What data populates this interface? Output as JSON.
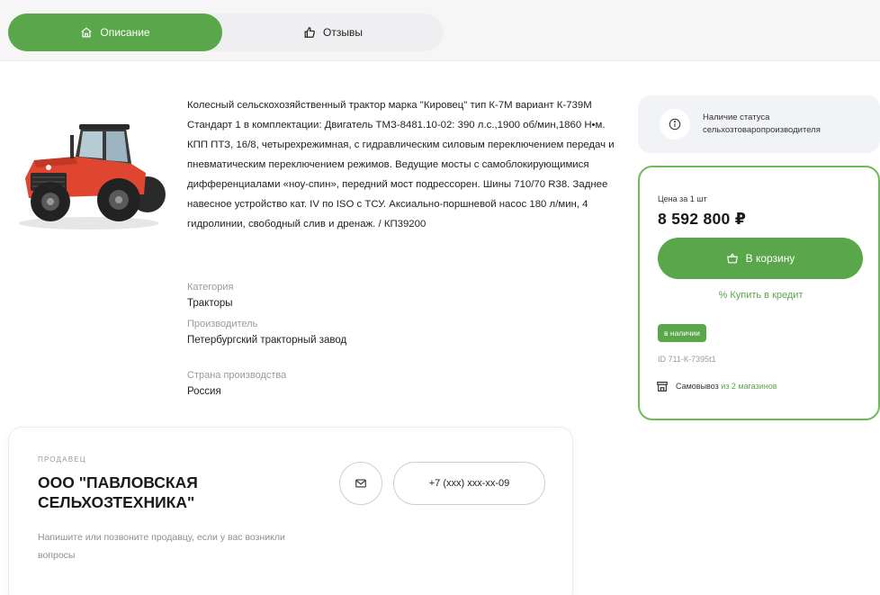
{
  "tabs": [
    {
      "label": "Описание",
      "icon": "home-icon",
      "active": true
    },
    {
      "label": "Отзывы",
      "icon": "thumbs-up-icon",
      "active": false
    }
  ],
  "product": {
    "description": "Колесный сельскохозяйственный трактор марка \"Кировец\" тип К-7М вариант К-739М Стандарт 1 в комплектации: Двигатель ТМЗ-8481.10-02: 390 л.с.,1900 об/мин,1860 Н•м. КПП ПТЗ, 16/8, четырехрежимная, с гидравлическим силовым переключением передач и пневматическим переключением режимов. Ведущие мосты с самоблокирующимися дифференциалами «ноу-спин», передний мост подрессорен. Шины 710/70 R38. Заднее навесное устройство кат. IV по ISO с ТСУ. Аксиально-поршневой насос 180 л/мин, 4 гидролинии, свободный слив и дренаж. / КП39200",
    "attributes": [
      {
        "label": "Категория",
        "value": "Тракторы"
      },
      {
        "label": "Производитель",
        "value": "Петербургский тракторный завод"
      },
      {
        "label": "Страна производства",
        "value": "Россия"
      }
    ]
  },
  "status_card": {
    "icon": "info-icon",
    "text_line1": "Наличие статуса",
    "text_line2": "сельхозтоваропроизводителя"
  },
  "price_card": {
    "price_label": "Цена за 1 шт",
    "price": "8 592 800 ₽",
    "cart_label": "В корзину",
    "credit_label": "% Купить в кредит",
    "stock_label": "в наличии",
    "product_id": "ID 711-К-7395t1",
    "pickup_label": "Самовывоз",
    "pickup_link": "из 2 магазинов"
  },
  "seller": {
    "caption": "ПРОДАВЕЦ",
    "name": "ООО \"ПАВЛОВСКАЯ СЕЛЬХОЗТЕХНИКА\"",
    "hint": "Напишите или позвоните продавцу, если у вас возникли вопросы",
    "phone": "+7 (xxx) xxx-xx-09"
  },
  "colors": {
    "accent": "#5aa64a",
    "accent_border": "#6dbb5a",
    "tractor_body": "#e0452f"
  }
}
